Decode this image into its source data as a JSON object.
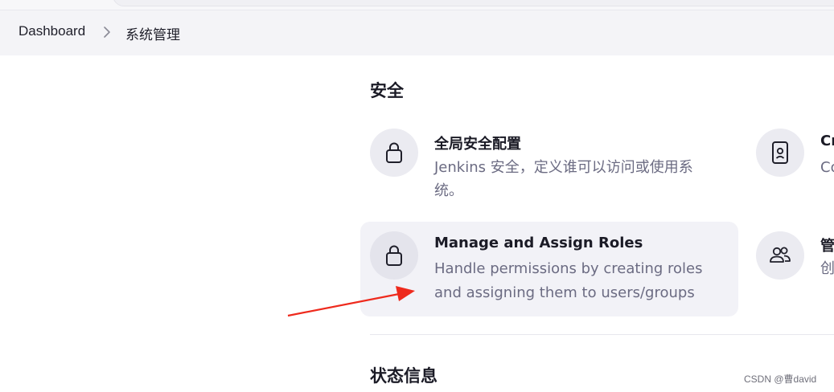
{
  "breadcrumb": {
    "items": [
      "Dashboard",
      "系统管理"
    ]
  },
  "sections": {
    "security": {
      "title": "安全",
      "cards": [
        {
          "title": "全局安全配置",
          "description_line1": "Jenkins 安全，定义谁可以访问或使用系",
          "description_line2": "统。",
          "icon": "lock-icon"
        },
        {
          "title": "Cr",
          "description": "Co",
          "icon": "id-badge-icon"
        },
        {
          "title": "Manage and Assign Roles",
          "description_line1": "Handle permissions by creating roles",
          "description_line2": "and assigning them to users/groups",
          "icon": "lock-icon",
          "highlighted": true
        },
        {
          "title": "管",
          "description": "创",
          "icon": "users-icon"
        }
      ]
    },
    "status": {
      "title": "状态信息"
    }
  },
  "annotation": {
    "color": "#ee2a1d"
  },
  "watermark": "CSDN @曹david"
}
